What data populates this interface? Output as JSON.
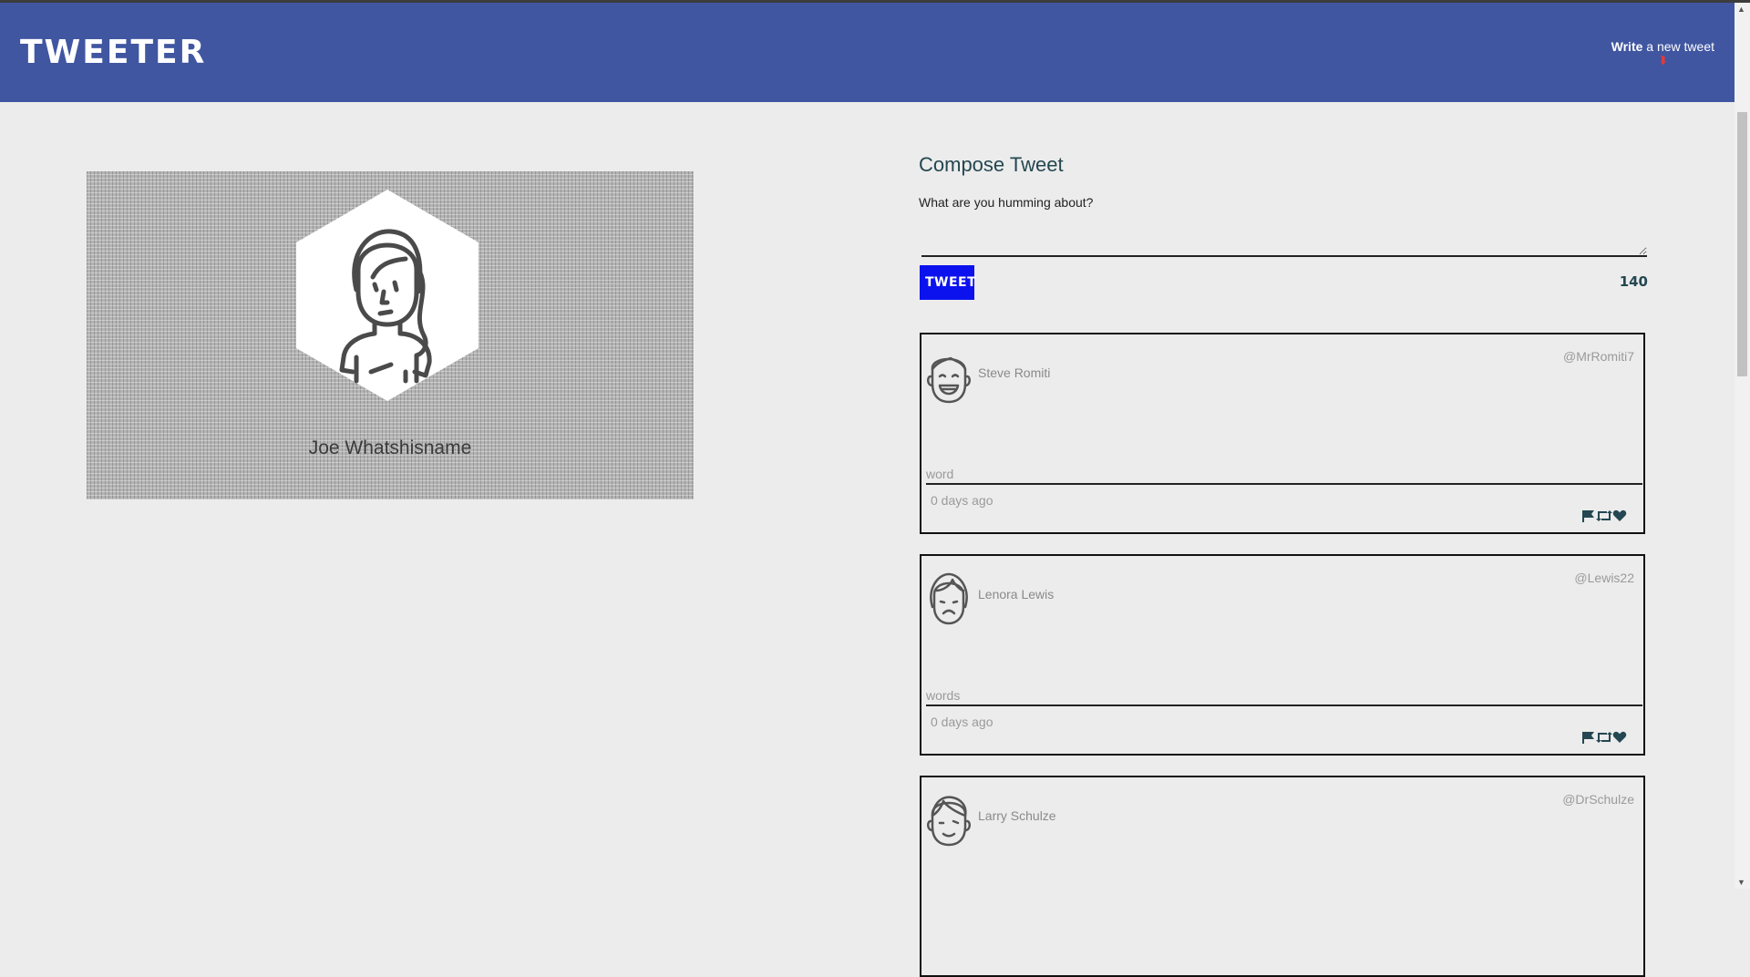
{
  "nav": {
    "logo": "TWEETER",
    "compose_toggle": {
      "strong": "Write",
      "rest": " a new tweet",
      "icon": "double-chevron-down-icon"
    }
  },
  "profile": {
    "name": "Joe Whatshisname",
    "avatar_icon": "woman-avatar-icon"
  },
  "compose": {
    "title": "Compose Tweet",
    "label": "What are you humming about?",
    "textarea_value": "",
    "button_label": "TWEET",
    "counter": "140"
  },
  "tweets": [
    {
      "name": "Steve Romiti",
      "handle": "@MrRomiti7",
      "content": "word",
      "time": "0 days ago",
      "avatar_icon": "laughing-man-avatar-icon"
    },
    {
      "name": "Lenora Lewis",
      "handle": "@Lewis22",
      "content": "words",
      "time": "0 days ago",
      "avatar_icon": "sad-woman-avatar-icon"
    },
    {
      "name": "Larry Schulze",
      "handle": "@DrSchulze",
      "content": "",
      "time": "",
      "avatar_icon": "smiling-man-avatar-icon"
    }
  ],
  "colors": {
    "navbar": "#4056a1",
    "background": "#ececec",
    "tweet_button": "#0c12ee",
    "text": "#244751",
    "chevron": "#e53935"
  }
}
